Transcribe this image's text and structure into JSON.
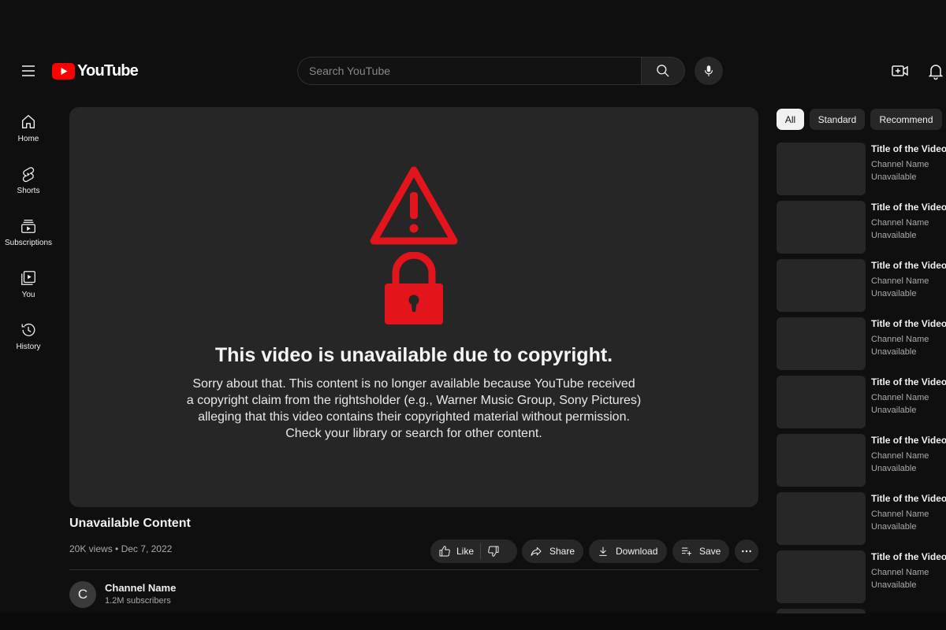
{
  "masthead": {
    "logo_text": "YouTube",
    "search_placeholder": "Search YouTube"
  },
  "guide": [
    {
      "label": "Home",
      "icon": "home-icon"
    },
    {
      "label": "Shorts",
      "icon": "shorts-icon"
    },
    {
      "label": "Subscriptions",
      "icon": "subscriptions-icon"
    },
    {
      "label": "You",
      "icon": "you-icon"
    },
    {
      "label": "History",
      "icon": "history-icon"
    }
  ],
  "player": {
    "error_title": "This video is unavailable due to copyright.",
    "error_lines": [
      "Sorry about that. This content is no longer available because YouTube received",
      "a copyright claim from the rightsholder (e.g., Warner Music Group, Sony Pictures)",
      "alleging that this video contains their copyrighted material without permission.",
      "Check your library or search for other content."
    ],
    "icon_color": "#e3141b"
  },
  "video": {
    "title": "Unavailable Content",
    "views": "20K views",
    "date": "Dec 7, 2022"
  },
  "actions": {
    "like": "Like",
    "share": "Share",
    "download": "Download",
    "save": "Save"
  },
  "channel": {
    "initial": "C",
    "name": "Channel Name",
    "subscribers": "1.2M subscribers"
  },
  "chips": [
    {
      "label": "All",
      "active": true
    },
    {
      "label": "Standard",
      "active": false
    },
    {
      "label": "Recommend",
      "active": false
    }
  ],
  "recommendations": [
    {
      "title": "Title of the Video",
      "channel": "Channel Name",
      "status": "Unavailable"
    },
    {
      "title": "Title of the Video",
      "channel": "Channel Name",
      "status": "Unavailable"
    },
    {
      "title": "Title of the Video",
      "channel": "Channel Name",
      "status": "Unavailable"
    },
    {
      "title": "Title of the Video",
      "channel": "Channel Name",
      "status": "Unavailable"
    },
    {
      "title": "Title of the Video",
      "channel": "Channel Name",
      "status": "Unavailable"
    },
    {
      "title": "Title of the Video",
      "channel": "Channel Name",
      "status": "Unavailable"
    },
    {
      "title": "Title of the Video",
      "channel": "Channel Name",
      "status": "Unavailable"
    },
    {
      "title": "Title of the Video",
      "channel": "Channel Name",
      "status": "Unavailable"
    }
  ],
  "colors": {
    "background": "#0f0f0f",
    "surface": "#272727",
    "brand_red": "#ff0000",
    "alert_red": "#e3141b"
  }
}
